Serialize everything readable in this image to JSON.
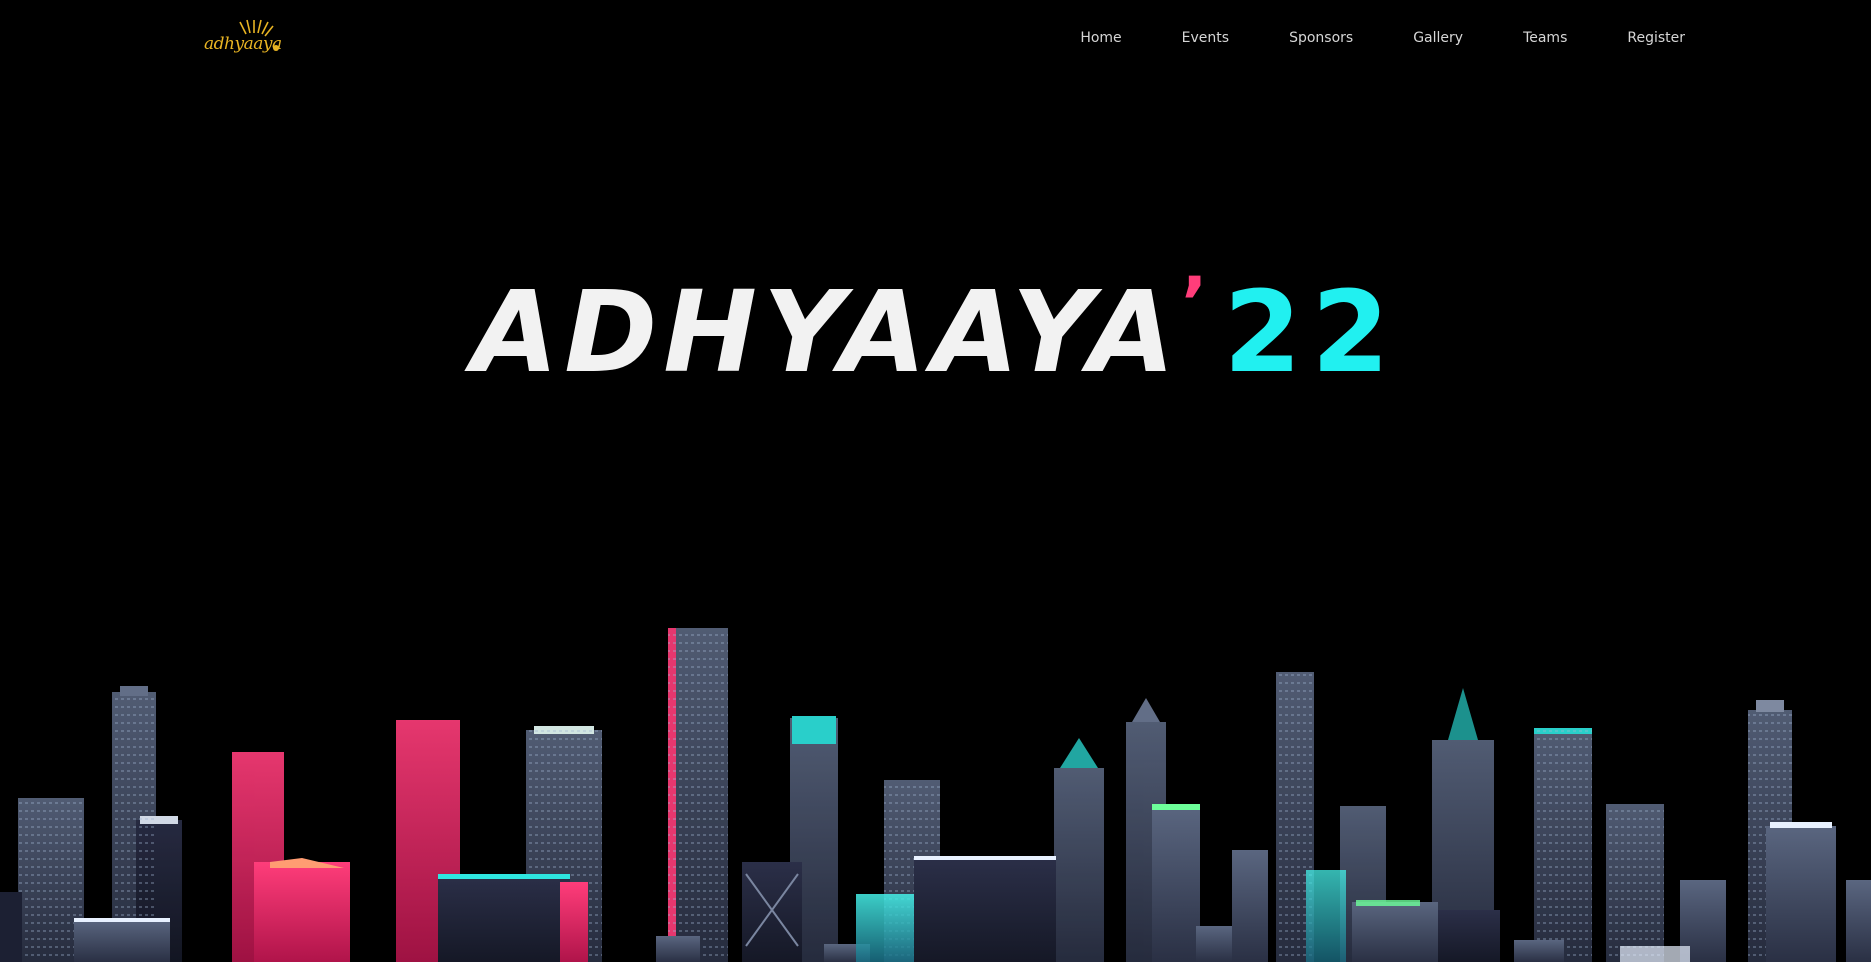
{
  "header": {
    "logo_text": "adhyaaya",
    "logo_color": "#e8b423"
  },
  "nav": {
    "items": [
      {
        "label": "Home"
      },
      {
        "label": "Events"
      },
      {
        "label": "Sponsors"
      },
      {
        "label": "Gallery"
      },
      {
        "label": "Teams"
      },
      {
        "label": "Register"
      }
    ]
  },
  "hero": {
    "name": "ADHYAAYA",
    "apostrophe": "’",
    "year": "22",
    "colors": {
      "name": "#f2f2f2",
      "apostrophe": "#ff3d7a",
      "year": "#21f0f0"
    }
  },
  "background": {
    "color": "#000000",
    "skyline_palette": [
      "#4a5570",
      "#ff2b6b",
      "#2ee6e0",
      "#6dff9a",
      "#1c2033"
    ]
  }
}
